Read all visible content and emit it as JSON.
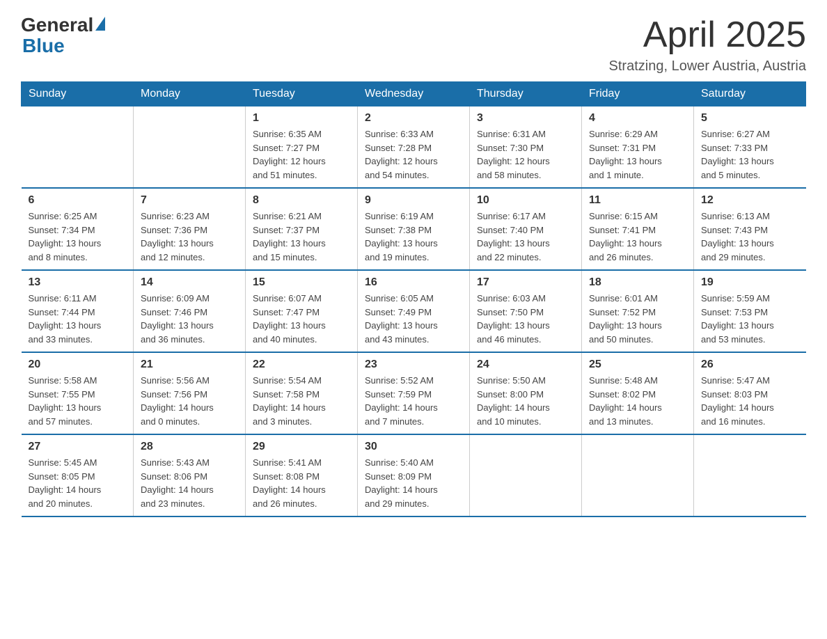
{
  "header": {
    "logo_general": "General",
    "logo_blue": "Blue",
    "month_year": "April 2025",
    "location": "Stratzing, Lower Austria, Austria"
  },
  "calendar": {
    "weekdays": [
      "Sunday",
      "Monday",
      "Tuesday",
      "Wednesday",
      "Thursday",
      "Friday",
      "Saturday"
    ],
    "weeks": [
      [
        {
          "day": "",
          "info": ""
        },
        {
          "day": "",
          "info": ""
        },
        {
          "day": "1",
          "info": "Sunrise: 6:35 AM\nSunset: 7:27 PM\nDaylight: 12 hours\nand 51 minutes."
        },
        {
          "day": "2",
          "info": "Sunrise: 6:33 AM\nSunset: 7:28 PM\nDaylight: 12 hours\nand 54 minutes."
        },
        {
          "day": "3",
          "info": "Sunrise: 6:31 AM\nSunset: 7:30 PM\nDaylight: 12 hours\nand 58 minutes."
        },
        {
          "day": "4",
          "info": "Sunrise: 6:29 AM\nSunset: 7:31 PM\nDaylight: 13 hours\nand 1 minute."
        },
        {
          "day": "5",
          "info": "Sunrise: 6:27 AM\nSunset: 7:33 PM\nDaylight: 13 hours\nand 5 minutes."
        }
      ],
      [
        {
          "day": "6",
          "info": "Sunrise: 6:25 AM\nSunset: 7:34 PM\nDaylight: 13 hours\nand 8 minutes."
        },
        {
          "day": "7",
          "info": "Sunrise: 6:23 AM\nSunset: 7:36 PM\nDaylight: 13 hours\nand 12 minutes."
        },
        {
          "day": "8",
          "info": "Sunrise: 6:21 AM\nSunset: 7:37 PM\nDaylight: 13 hours\nand 15 minutes."
        },
        {
          "day": "9",
          "info": "Sunrise: 6:19 AM\nSunset: 7:38 PM\nDaylight: 13 hours\nand 19 minutes."
        },
        {
          "day": "10",
          "info": "Sunrise: 6:17 AM\nSunset: 7:40 PM\nDaylight: 13 hours\nand 22 minutes."
        },
        {
          "day": "11",
          "info": "Sunrise: 6:15 AM\nSunset: 7:41 PM\nDaylight: 13 hours\nand 26 minutes."
        },
        {
          "day": "12",
          "info": "Sunrise: 6:13 AM\nSunset: 7:43 PM\nDaylight: 13 hours\nand 29 minutes."
        }
      ],
      [
        {
          "day": "13",
          "info": "Sunrise: 6:11 AM\nSunset: 7:44 PM\nDaylight: 13 hours\nand 33 minutes."
        },
        {
          "day": "14",
          "info": "Sunrise: 6:09 AM\nSunset: 7:46 PM\nDaylight: 13 hours\nand 36 minutes."
        },
        {
          "day": "15",
          "info": "Sunrise: 6:07 AM\nSunset: 7:47 PM\nDaylight: 13 hours\nand 40 minutes."
        },
        {
          "day": "16",
          "info": "Sunrise: 6:05 AM\nSunset: 7:49 PM\nDaylight: 13 hours\nand 43 minutes."
        },
        {
          "day": "17",
          "info": "Sunrise: 6:03 AM\nSunset: 7:50 PM\nDaylight: 13 hours\nand 46 minutes."
        },
        {
          "day": "18",
          "info": "Sunrise: 6:01 AM\nSunset: 7:52 PM\nDaylight: 13 hours\nand 50 minutes."
        },
        {
          "day": "19",
          "info": "Sunrise: 5:59 AM\nSunset: 7:53 PM\nDaylight: 13 hours\nand 53 minutes."
        }
      ],
      [
        {
          "day": "20",
          "info": "Sunrise: 5:58 AM\nSunset: 7:55 PM\nDaylight: 13 hours\nand 57 minutes."
        },
        {
          "day": "21",
          "info": "Sunrise: 5:56 AM\nSunset: 7:56 PM\nDaylight: 14 hours\nand 0 minutes."
        },
        {
          "day": "22",
          "info": "Sunrise: 5:54 AM\nSunset: 7:58 PM\nDaylight: 14 hours\nand 3 minutes."
        },
        {
          "day": "23",
          "info": "Sunrise: 5:52 AM\nSunset: 7:59 PM\nDaylight: 14 hours\nand 7 minutes."
        },
        {
          "day": "24",
          "info": "Sunrise: 5:50 AM\nSunset: 8:00 PM\nDaylight: 14 hours\nand 10 minutes."
        },
        {
          "day": "25",
          "info": "Sunrise: 5:48 AM\nSunset: 8:02 PM\nDaylight: 14 hours\nand 13 minutes."
        },
        {
          "day": "26",
          "info": "Sunrise: 5:47 AM\nSunset: 8:03 PM\nDaylight: 14 hours\nand 16 minutes."
        }
      ],
      [
        {
          "day": "27",
          "info": "Sunrise: 5:45 AM\nSunset: 8:05 PM\nDaylight: 14 hours\nand 20 minutes."
        },
        {
          "day": "28",
          "info": "Sunrise: 5:43 AM\nSunset: 8:06 PM\nDaylight: 14 hours\nand 23 minutes."
        },
        {
          "day": "29",
          "info": "Sunrise: 5:41 AM\nSunset: 8:08 PM\nDaylight: 14 hours\nand 26 minutes."
        },
        {
          "day": "30",
          "info": "Sunrise: 5:40 AM\nSunset: 8:09 PM\nDaylight: 14 hours\nand 29 minutes."
        },
        {
          "day": "",
          "info": ""
        },
        {
          "day": "",
          "info": ""
        },
        {
          "day": "",
          "info": ""
        }
      ]
    ]
  }
}
